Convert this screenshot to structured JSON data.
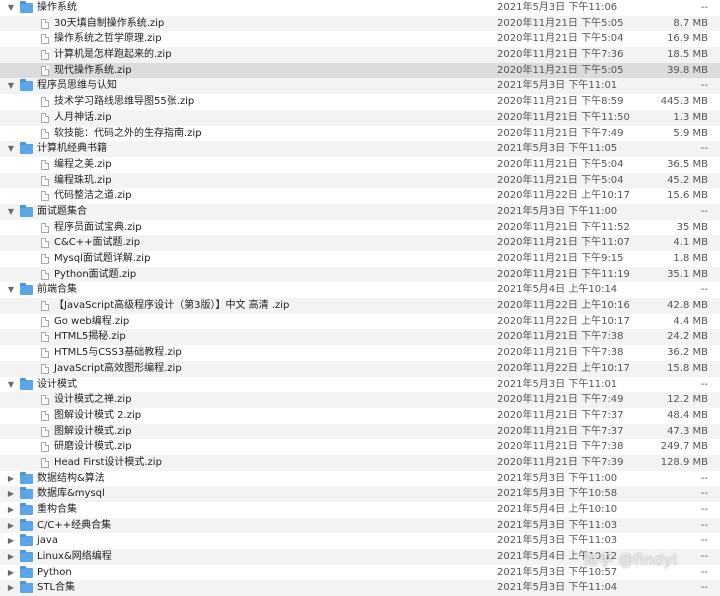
{
  "rows": [
    {
      "type": "folder",
      "expanded": true,
      "name": "操作系统",
      "date": "2021年5月3日 下午11:06",
      "size": "--"
    },
    {
      "type": "file",
      "name": "30天填自制操作系统.zip",
      "date": "2020年11月21日 下午5:05",
      "size": "8.7 MB"
    },
    {
      "type": "file",
      "name": "操作系统之哲学原理.zip",
      "date": "2020年11月21日 下午5:04",
      "size": "16.9 MB"
    },
    {
      "type": "file",
      "name": "计算机是怎样跑起来的.zip",
      "date": "2020年11月21日 下午7:36",
      "size": "18.5 MB"
    },
    {
      "type": "file",
      "name": "现代操作系统.zip",
      "date": "2020年11月21日 下午5:05",
      "size": "39.8 MB",
      "selected": true
    },
    {
      "type": "folder",
      "expanded": true,
      "name": "程序员思维与认知",
      "date": "2021年5月3日 下午11:01",
      "size": "--"
    },
    {
      "type": "file",
      "name": "技术学习路线思维导图55张.zip",
      "date": "2020年11月21日 下午8:59",
      "size": "445.3 MB"
    },
    {
      "type": "file",
      "name": "人月神话.zip",
      "date": "2020年11月21日 下午11:50",
      "size": "1.3 MB"
    },
    {
      "type": "file",
      "name": "软技能：代码之外的生存指南.zip",
      "date": "2020年11月21日 下午7:49",
      "size": "5.9 MB"
    },
    {
      "type": "folder",
      "expanded": true,
      "name": "计算机经典书籍",
      "date": "2021年5月3日 下午11:05",
      "size": "--"
    },
    {
      "type": "file",
      "name": "编程之美.zip",
      "date": "2020年11月21日 下午5:04",
      "size": "36.5 MB"
    },
    {
      "type": "file",
      "name": "编程珠玑.zip",
      "date": "2020年11月21日 下午5:04",
      "size": "45.2 MB"
    },
    {
      "type": "file",
      "name": "代码整洁之道.zip",
      "date": "2020年11月22日 上午10:17",
      "size": "15.6 MB"
    },
    {
      "type": "folder",
      "expanded": true,
      "name": "面试题集合",
      "date": "2021年5月3日 下午11:00",
      "size": "--"
    },
    {
      "type": "file",
      "name": "程序员面试宝典.zip",
      "date": "2020年11月21日 下午11:52",
      "size": "35 MB"
    },
    {
      "type": "file",
      "name": "C&C++面试题.zip",
      "date": "2020年11月21日 下午11:07",
      "size": "4.1 MB"
    },
    {
      "type": "file",
      "name": "Mysql面试题详解.zip",
      "date": "2020年11月21日 下午9:15",
      "size": "1.8 MB"
    },
    {
      "type": "file",
      "name": "Python面试题.zip",
      "date": "2020年11月21日 下午11:19",
      "size": "35.1 MB"
    },
    {
      "type": "folder",
      "expanded": true,
      "name": "前端合集",
      "date": "2021年5月4日 上午10:14",
      "size": "--"
    },
    {
      "type": "file",
      "name": "【JavaScript高级程序设计（第3版）】中文 高清 .zip",
      "date": "2020年11月22日 上午10:16",
      "size": "42.8 MB"
    },
    {
      "type": "file",
      "name": "Go web编程.zip",
      "date": "2020年11月22日 上午10:17",
      "size": "4.4 MB"
    },
    {
      "type": "file",
      "name": "HTML5揭秘.zip",
      "date": "2020年11月21日 下午7:38",
      "size": "24.2 MB"
    },
    {
      "type": "file",
      "name": "HTML5与CSS3基础教程.zip",
      "date": "2020年11月21日 下午7:38",
      "size": "36.2 MB"
    },
    {
      "type": "file",
      "name": "JavaScript高效图形编程.zip",
      "date": "2020年11月22日 上午10:17",
      "size": "15.8 MB"
    },
    {
      "type": "folder",
      "expanded": true,
      "name": "设计模式",
      "date": "2021年5月3日 下午11:01",
      "size": "--"
    },
    {
      "type": "file",
      "name": "设计模式之禅.zip",
      "date": "2020年11月21日 下午7:49",
      "size": "12.2 MB"
    },
    {
      "type": "file",
      "name": "图解设计模式 2.zip",
      "date": "2020年11月21日 下午7:37",
      "size": "48.4 MB"
    },
    {
      "type": "file",
      "name": "图解设计模式.zip",
      "date": "2020年11月21日 下午7:37",
      "size": "47.3 MB"
    },
    {
      "type": "file",
      "name": "研磨设计模式.zip",
      "date": "2020年11月21日 下午7:38",
      "size": "249.7 MB"
    },
    {
      "type": "file",
      "name": "Head First设计模式.zip",
      "date": "2020年11月21日 下午7:39",
      "size": "128.9 MB"
    },
    {
      "type": "folder",
      "expanded": false,
      "name": "数据结构&算法",
      "date": "2021年5月3日 下午11:00",
      "size": "--"
    },
    {
      "type": "folder",
      "expanded": false,
      "name": "数据库&mysql",
      "date": "2021年5月3日 下午10:58",
      "size": "--"
    },
    {
      "type": "folder",
      "expanded": false,
      "name": "重构合集",
      "date": "2021年5月4日 上午10:10",
      "size": "--"
    },
    {
      "type": "folder",
      "expanded": false,
      "name": "C/C++经典合集",
      "date": "2021年5月3日 下午11:03",
      "size": "--"
    },
    {
      "type": "folder",
      "expanded": false,
      "name": "java",
      "date": "2021年5月3日 下午11:03",
      "size": "--"
    },
    {
      "type": "folder",
      "expanded": false,
      "name": "Linux&网络编程",
      "date": "2021年5月4日 上午10:12",
      "size": "--"
    },
    {
      "type": "folder",
      "expanded": false,
      "name": "Python",
      "date": "2021年5月3日 下午10:57",
      "size": "--"
    },
    {
      "type": "folder",
      "expanded": false,
      "name": "STL合集",
      "date": "2021年5月3日 下午11:04",
      "size": "--"
    }
  ],
  "watermark": "知乎 @findyi"
}
